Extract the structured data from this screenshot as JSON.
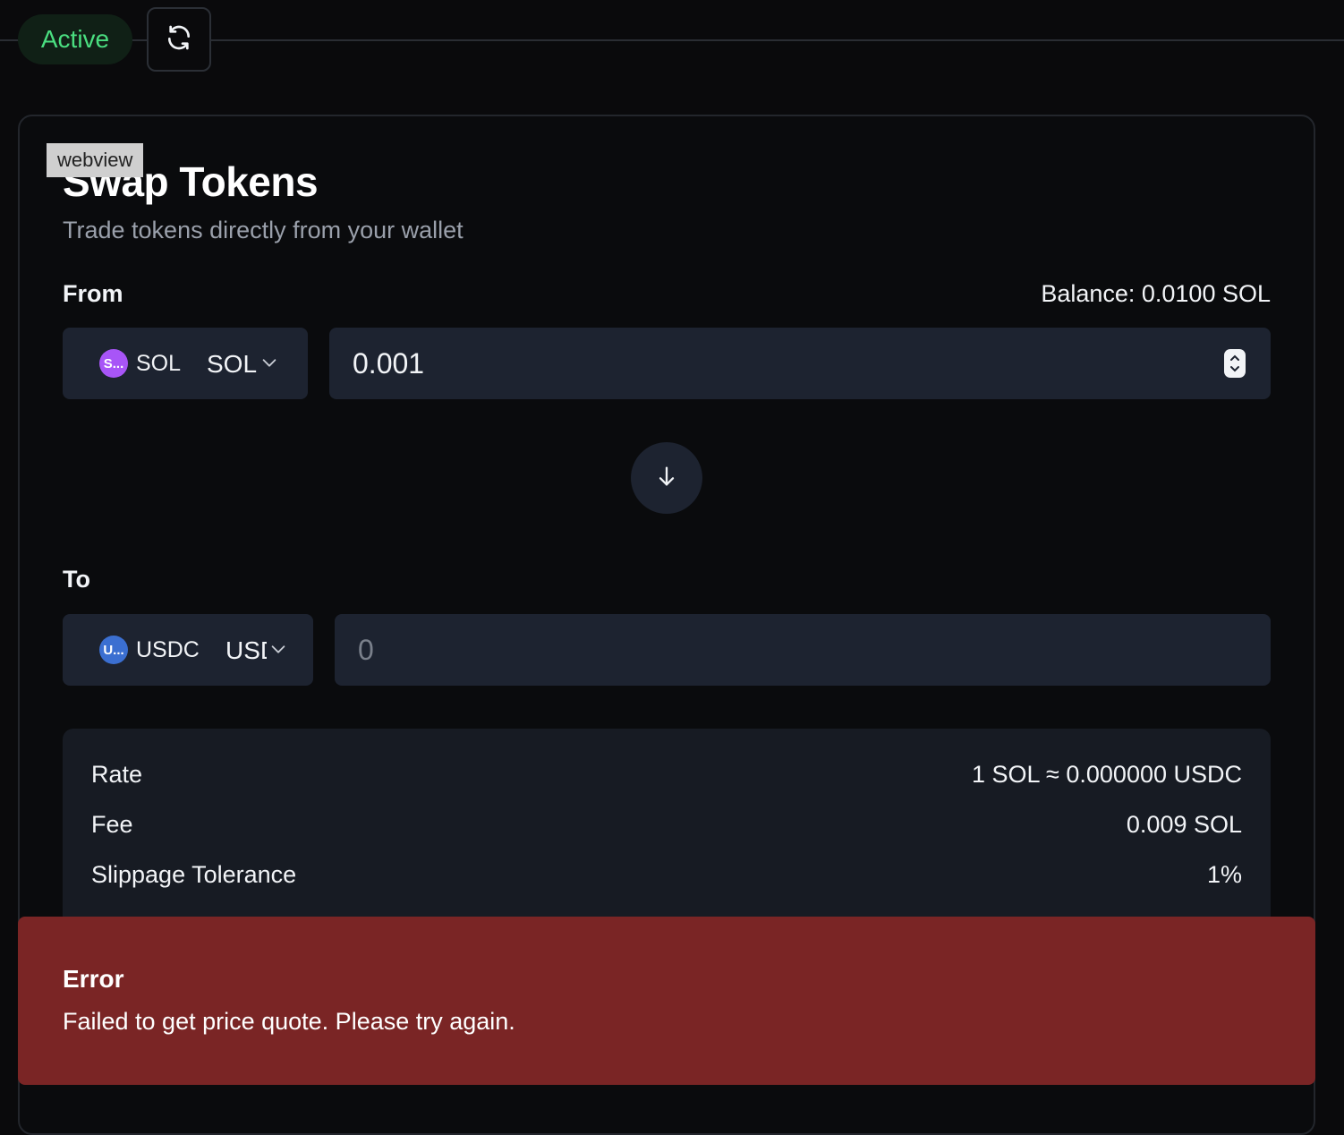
{
  "header": {
    "status": "Active",
    "refresh_icon": "refresh-icon",
    "colors": {
      "status_text": "#4ade80",
      "status_bg": "#102016"
    }
  },
  "overlay_tag": "webview",
  "swap": {
    "title": "Swap Tokens",
    "subtitle": "Trade tokens directly from your wallet",
    "from": {
      "label": "From",
      "balance": "Balance: 0.0100 SOL",
      "token_badge": "S...",
      "token_name": "SOL",
      "token_value": "SOL",
      "badge_color": "#a855f7",
      "amount": "0.001"
    },
    "swap_direction_icon": "arrow-down-icon",
    "to": {
      "label": "To",
      "token_badge": "U...",
      "token_name": "USDC",
      "token_value": "USDC",
      "badge_color": "#3b6fd1",
      "amount_placeholder": "0"
    },
    "details": {
      "rate_label": "Rate",
      "rate_value": "1 SOL ≈ 0.000000 USDC",
      "fee_label": "Fee",
      "fee_value": "0.009 SOL",
      "slippage_label": "Slippage Tolerance",
      "slippage_value": "1%"
    }
  },
  "error": {
    "title": "Error",
    "message": "Failed to get price quote. Please try again.",
    "color": "#7a2525"
  }
}
